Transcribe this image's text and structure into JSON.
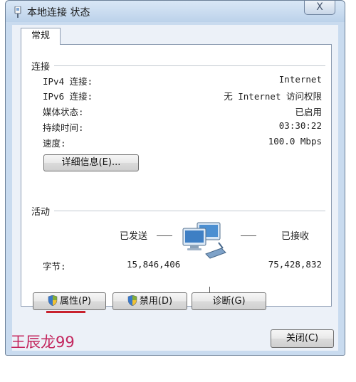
{
  "window": {
    "title": "本地连接 状态",
    "close_glyph": "X"
  },
  "tabs": [
    {
      "label": "常规"
    }
  ],
  "connection": {
    "heading": "连接",
    "rows": [
      {
        "label": "IPv4 连接:",
        "value": "Internet"
      },
      {
        "label": "IPv6 连接:",
        "value": "无 Internet 访问权限"
      },
      {
        "label": "媒体状态:",
        "value": "已启用"
      },
      {
        "label": "持续时间:",
        "value": "03:30:22"
      },
      {
        "label": "速度:",
        "value": "100.0 Mbps"
      }
    ],
    "details_button": "详细信息(E)..."
  },
  "activity": {
    "heading": "活动",
    "sent_label": "已发送",
    "received_label": "已接收",
    "bytes_label": "字节:",
    "bytes_sent": "15,846,406",
    "bytes_received": "75,428,832",
    "network_icon": "network-computers-icon"
  },
  "buttons": {
    "properties": "属性(P)",
    "disable": "禁用(D)",
    "diagnose": "诊断(G)",
    "close": "关闭(C)"
  },
  "overlay": {
    "signature": "王辰龙99"
  },
  "colors": {
    "frame": "#c9dbef",
    "signature": "#c3265e",
    "underline": "#c8222e"
  }
}
